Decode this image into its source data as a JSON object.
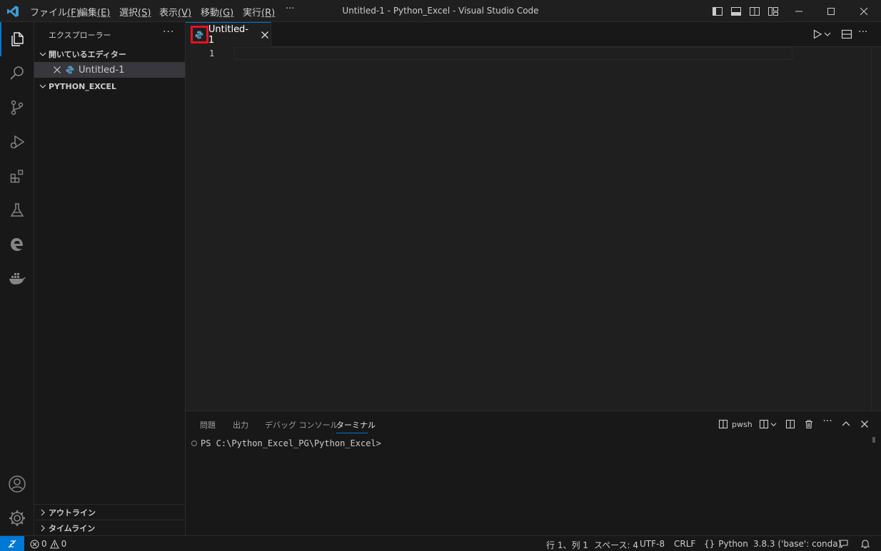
{
  "titlebar": {
    "menu": [
      {
        "label": "ファイル",
        "key": "(F)"
      },
      {
        "label": "編集",
        "key": "(E)"
      },
      {
        "label": "選択",
        "key": "(S)"
      },
      {
        "label": "表示",
        "key": "(V)"
      },
      {
        "label": "移動",
        "key": "(G)"
      },
      {
        "label": "実行",
        "key": "(R)"
      }
    ],
    "more": "···",
    "window_title": "Untitled-1 - Python_Excel - Visual Studio Code"
  },
  "sidebar": {
    "title": "エクスプローラー",
    "more": "···",
    "open_editors_header": "開いているエディター",
    "open_editor_file": "Untitled-1",
    "folder_header": "PYTHON_EXCEL",
    "outline_header": "アウトライン",
    "timeline_header": "タイムライン"
  },
  "editor": {
    "tab_label": "Untitled-1",
    "line_number": "1"
  },
  "panel": {
    "tabs": [
      "問題",
      "出力",
      "デバッグ コンソール",
      "ターミナル"
    ],
    "active_tab_index": 3,
    "terminal_name": "pwsh",
    "prompt": "PS C:\\Python_Excel_PG\\Python_Excel>"
  },
  "statusbar": {
    "errors": "0",
    "warnings": "0",
    "position": "行 1、列 1",
    "spaces": "スペース: 4",
    "encoding": "UTF-8",
    "eol": "CRLF",
    "language": "Python",
    "interpreter": "3.8.3 ('base': conda)"
  },
  "colors": {
    "accent": "#0078d4",
    "highlight_box": "#e81123",
    "python_icon": "#519aba"
  }
}
